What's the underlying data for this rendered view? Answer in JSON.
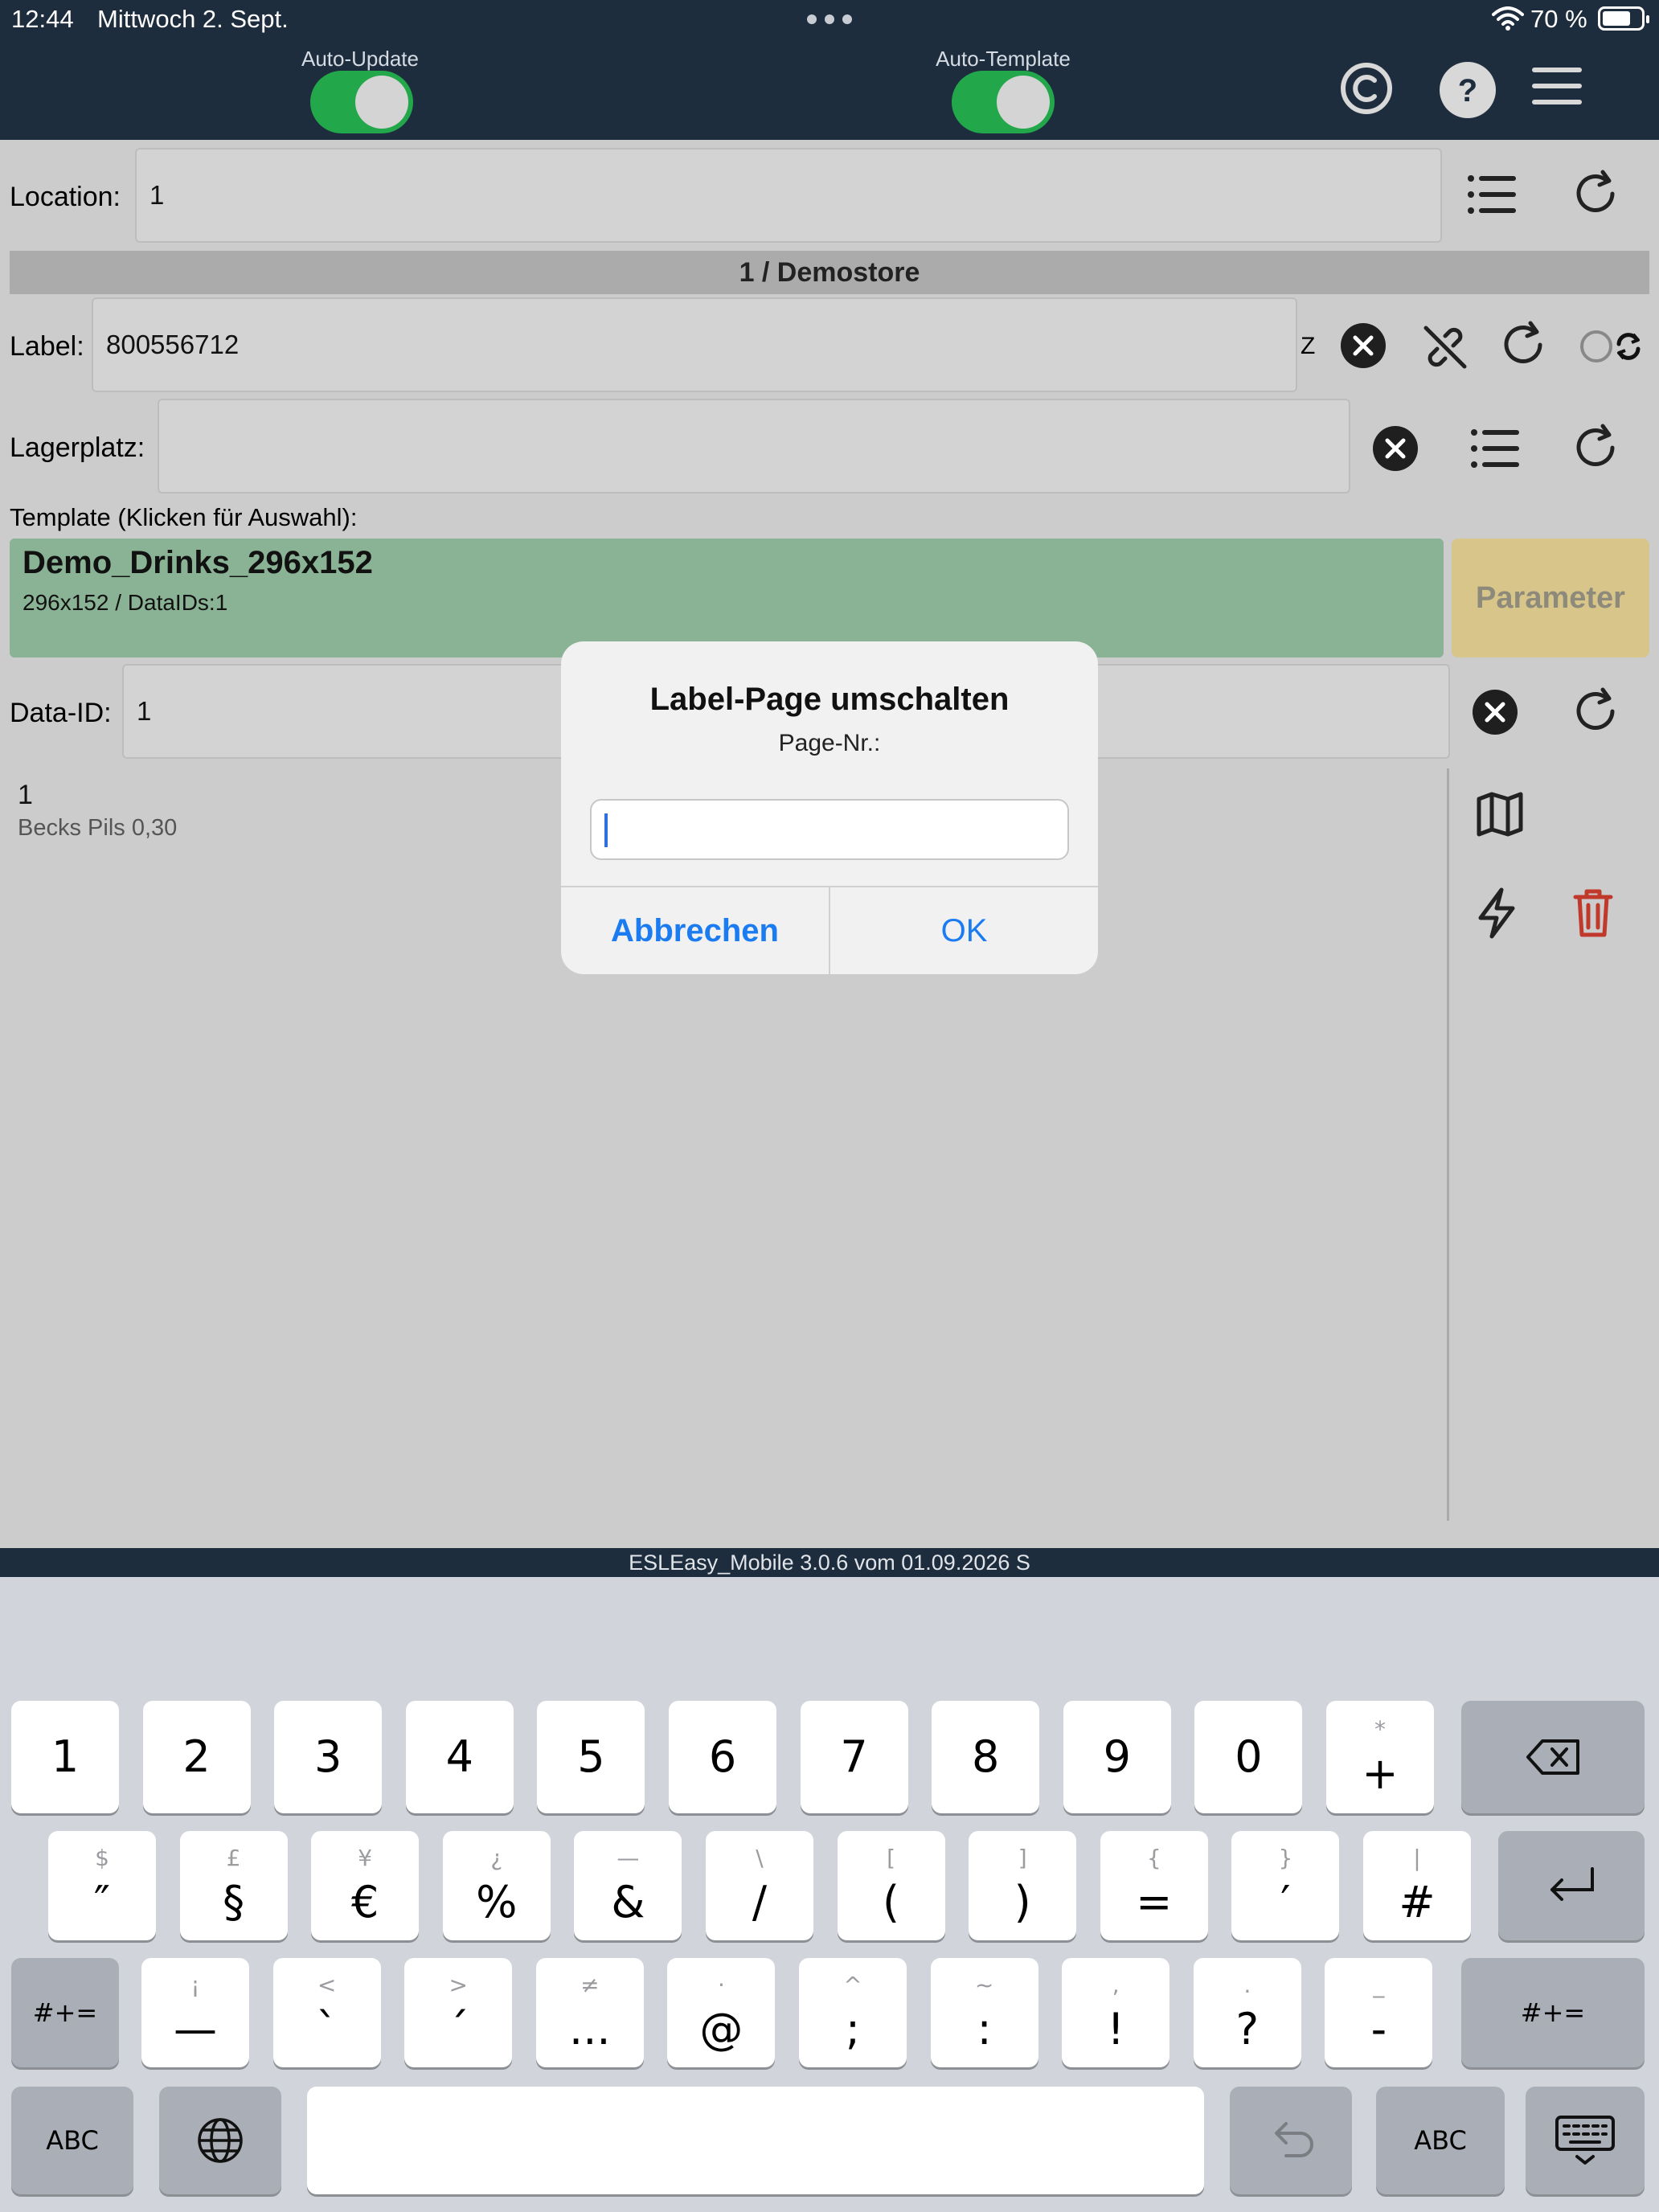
{
  "status_bar": {
    "time": "12:44",
    "date": "Mittwoch 2. Sept.",
    "battery": "70 %"
  },
  "toolbar": {
    "auto_update_label": "Auto-Update",
    "auto_update_on": true,
    "auto_template_label": "Auto-Template",
    "auto_template_on": true
  },
  "form": {
    "location_label": "Location:",
    "location_value": "1",
    "store_title": "1 / Demostore",
    "label_label": "Label:",
    "label_value": "800556712",
    "label_suffix": "Z",
    "lagerplatz_label": "Lagerplatz:",
    "lagerplatz_value": "",
    "template_caption": "Template (Klicken für Auswahl):",
    "template_name": "Demo_Drinks_296x152",
    "template_sub": "296x152 / DataIDs:1",
    "parameter_button": "Parameter",
    "data_id_label": "Data-ID:",
    "data_id_value": "1"
  },
  "list": {
    "items": [
      {
        "number": "1",
        "name": "Becks Pils 0,30"
      }
    ]
  },
  "footer": {
    "version": "ESLEasy_Mobile 3.0.6 vom 01.09.2026 S"
  },
  "dialog": {
    "title": "Label-Page umschalten",
    "message": "Page-Nr.:",
    "input_value": "",
    "cancel": "Abbrechen",
    "ok": "OK"
  },
  "colors": {
    "topbar": "#1e2d3e",
    "toggle_on": "#22a84b",
    "template_bg": "#8ab294",
    "parameter_bg": "#d8c589",
    "delete_red": "#c0392b",
    "dialog_button": "#1b7cf2"
  },
  "keyboard": {
    "row1": [
      {
        "main": "1",
        "alt": ""
      },
      {
        "main": "2",
        "alt": ""
      },
      {
        "main": "3",
        "alt": ""
      },
      {
        "main": "4",
        "alt": ""
      },
      {
        "main": "5",
        "alt": ""
      },
      {
        "main": "6",
        "alt": ""
      },
      {
        "main": "7",
        "alt": ""
      },
      {
        "main": "8",
        "alt": ""
      },
      {
        "main": "9",
        "alt": ""
      },
      {
        "main": "0",
        "alt": ""
      },
      {
        "main": "+",
        "alt": "*"
      }
    ],
    "row2": [
      {
        "main": "″",
        "alt": "$"
      },
      {
        "main": "§",
        "alt": "£"
      },
      {
        "main": "€",
        "alt": "¥"
      },
      {
        "main": "%",
        "alt": "¿"
      },
      {
        "main": "&",
        "alt": "—"
      },
      {
        "main": "/",
        "alt": "\\"
      },
      {
        "main": "(",
        "alt": "["
      },
      {
        "main": ")",
        "alt": "]"
      },
      {
        "main": "=",
        "alt": "{"
      },
      {
        "main": "′",
        "alt": "}"
      },
      {
        "main": "#",
        "alt": "|"
      }
    ],
    "row3_left": "#+=",
    "row3": [
      {
        "main": "—",
        "alt": "¡"
      },
      {
        "main": "`",
        "alt": "<"
      },
      {
        "main": "´",
        "alt": ">"
      },
      {
        "main": "...",
        "alt": "≠"
      },
      {
        "main": "@",
        "alt": "·"
      },
      {
        "main": ";",
        "alt": "^"
      },
      {
        "main": ":",
        "alt": "~"
      },
      {
        "main": "!",
        "alt": ","
      },
      {
        "main": "?",
        "alt": "."
      },
      {
        "main": "-",
        "alt": "_"
      }
    ],
    "row3_right": "#+=",
    "abc_left": "ABC",
    "abc_right": "ABC"
  }
}
